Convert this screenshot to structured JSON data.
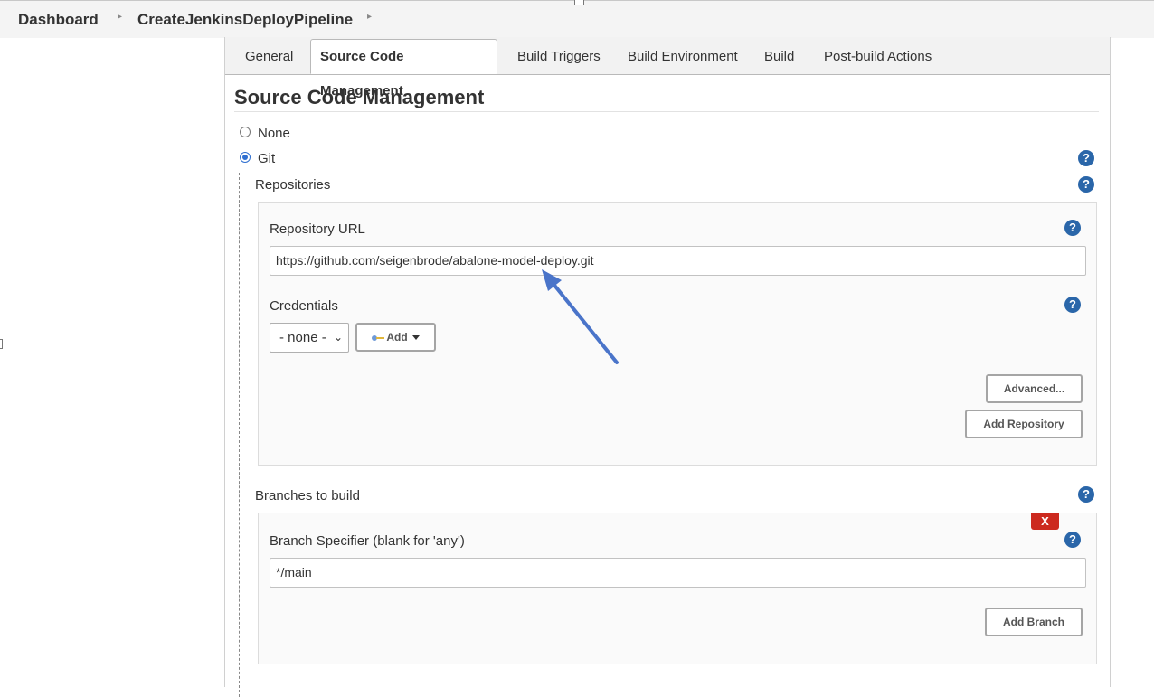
{
  "breadcrumb": {
    "items": [
      "Dashboard",
      "CreateJenkinsDeployPipeline"
    ]
  },
  "tabs": [
    {
      "label": "General",
      "active": false
    },
    {
      "label": "Source Code Management",
      "active": true
    },
    {
      "label": "Build Triggers",
      "active": false
    },
    {
      "label": "Build Environment",
      "active": false
    },
    {
      "label": "Build",
      "active": false
    },
    {
      "label": "Post-build Actions",
      "active": false
    }
  ],
  "scm": {
    "title": "Source Code Management",
    "options": [
      {
        "label": "None",
        "checked": false
      },
      {
        "label": "Git",
        "checked": true
      }
    ],
    "repositories": {
      "label": "Repositories",
      "url_label": "Repository URL",
      "url_value": "https://github.com/seigenbrode/abalone-model-deploy.git",
      "credentials_label": "Credentials",
      "credentials_selected": "- none -",
      "add_label": "Add",
      "advanced_label": "Advanced...",
      "add_repository_label": "Add Repository"
    },
    "branches": {
      "label": "Branches to build",
      "delete_label": "X",
      "specifier_label": "Branch Specifier (blank for 'any')",
      "specifier_value": "*/main",
      "add_branch_label": "Add Branch"
    }
  },
  "help_glyph": "?",
  "colors": {
    "help_icon": "#2a66a9",
    "radio_selected": "#2f6fd0",
    "delete_button": "#cc2a1f",
    "annotation_arrow": "#4a74c9"
  }
}
